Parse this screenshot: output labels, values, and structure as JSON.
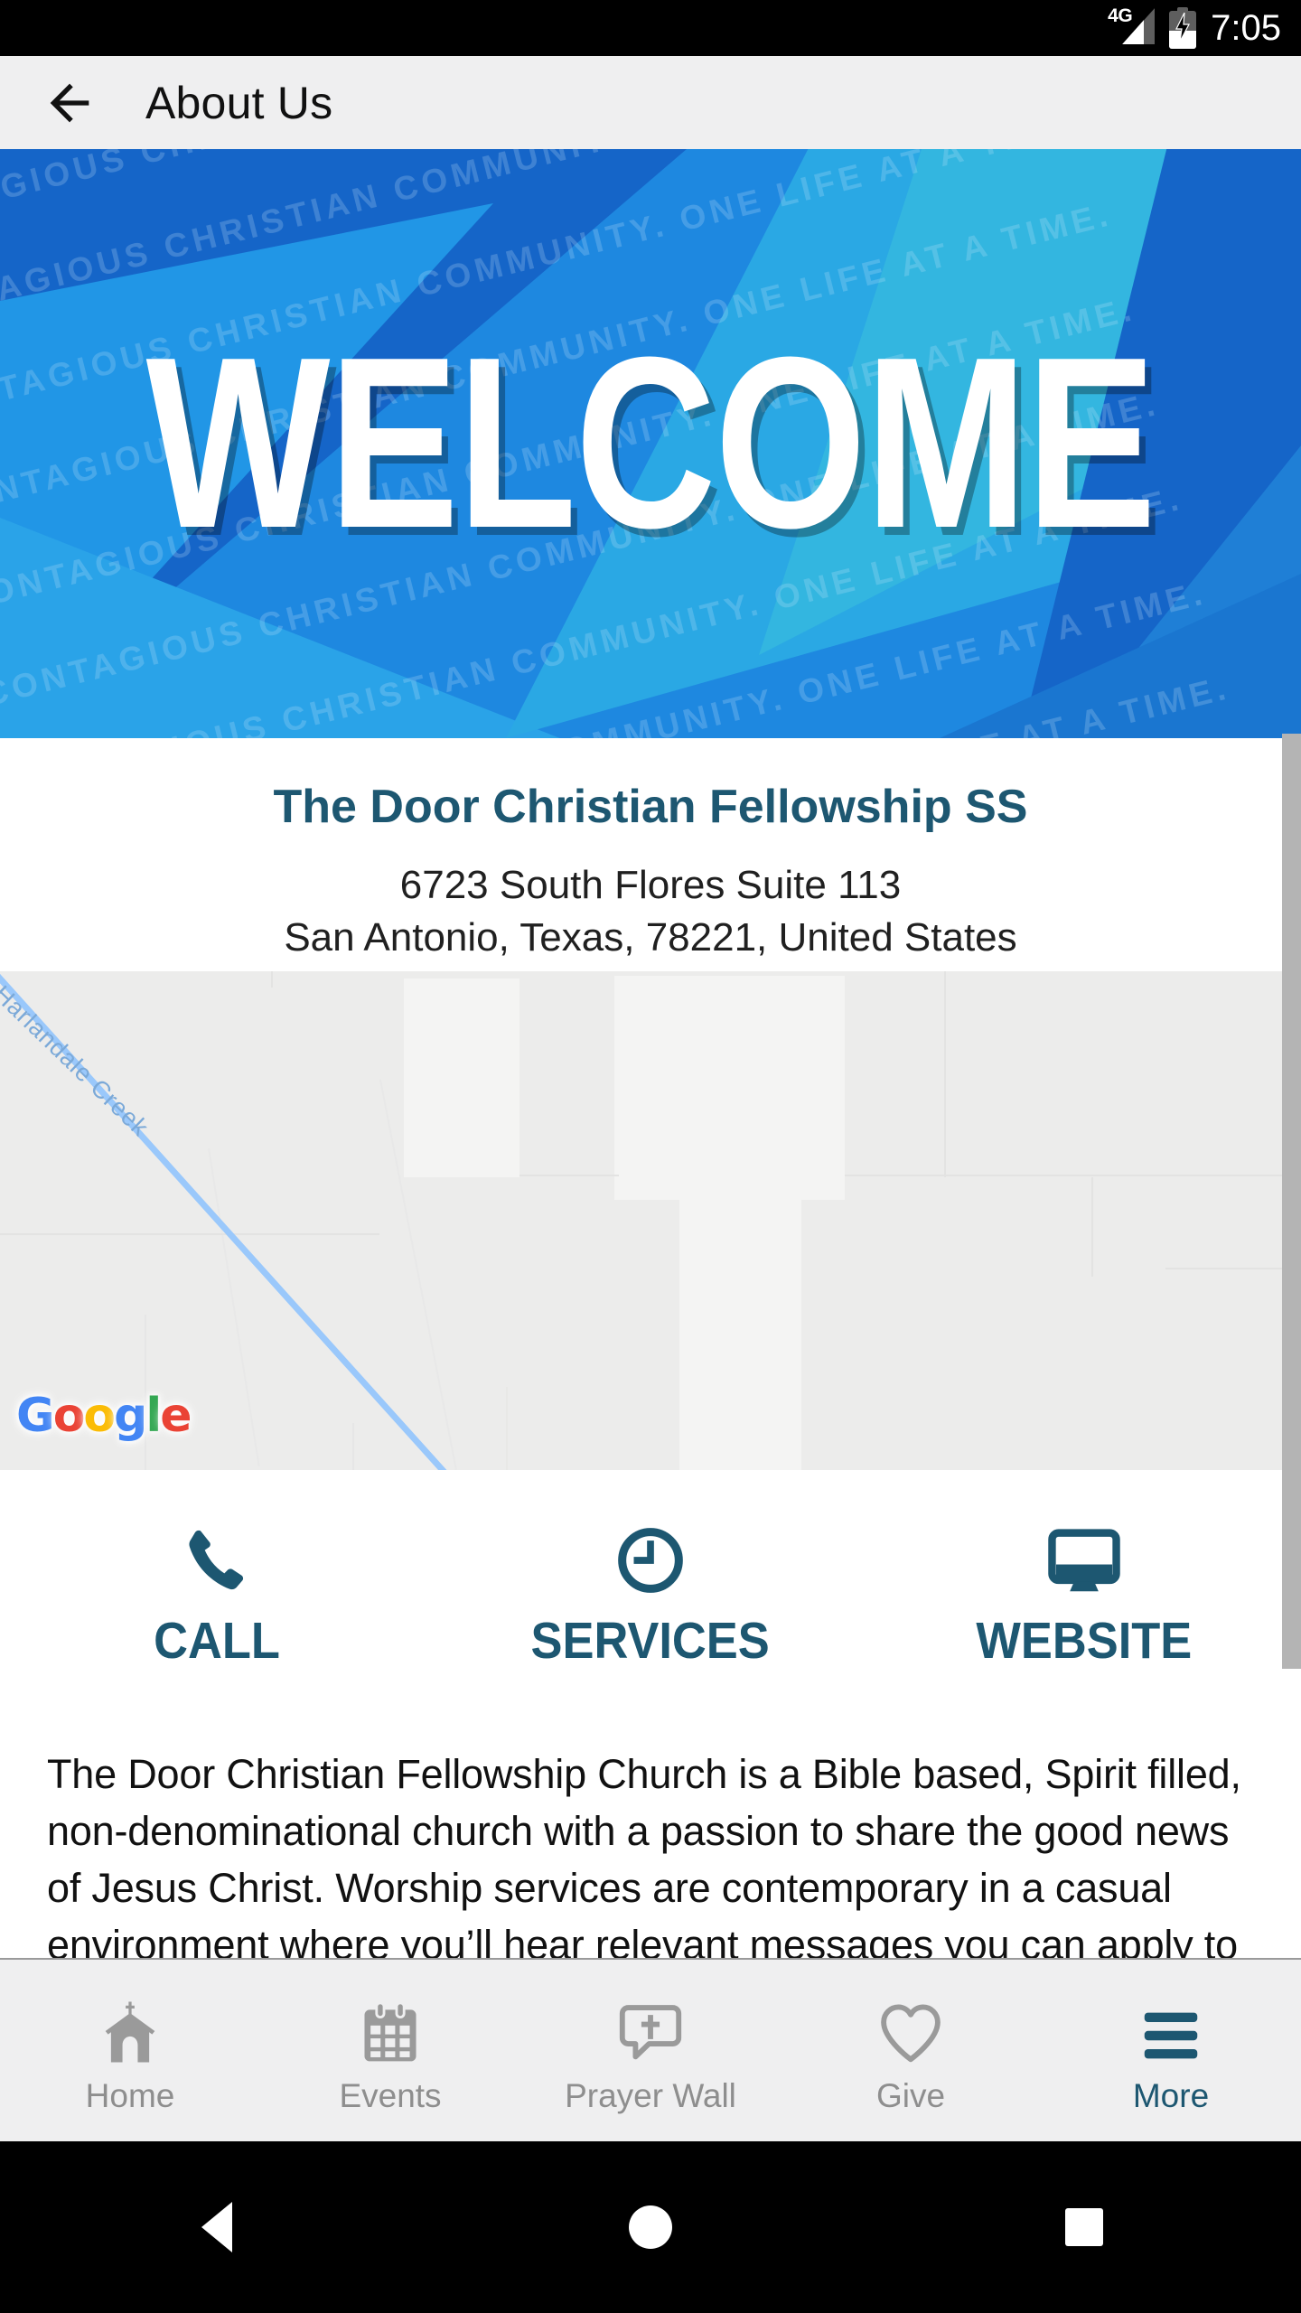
{
  "status_bar": {
    "network": "4G",
    "time": "7:05",
    "battery_icon": "battery-charging-icon",
    "signal_icon": "signal-bars-icon"
  },
  "app_bar": {
    "back_icon": "back-arrow-icon",
    "title": "About Us"
  },
  "hero": {
    "headline": "WELCOME",
    "watermark_text": "BUILDING A CONTAGIOUS CHRISTIAN COMMUNITY. ONE LIFE AT A TIME.",
    "colors": {
      "blue_dark": "#1565c8",
      "blue_mid": "#1e88e0",
      "blue_light": "#2aa3e8",
      "cyan": "#33b6e0"
    }
  },
  "org": {
    "name": "The Door Christian Fellowship SS",
    "address_line1": "6723 South Flores Suite 113",
    "address_line2": "San Antonio, Texas, 78221, United States",
    "name_color": "#1d5771"
  },
  "map": {
    "provider_logo": "Google",
    "provider_letters": [
      "G",
      "o",
      "o",
      "g",
      "l",
      "e"
    ],
    "creek_label": "Harlandale Creek",
    "marker_icon": "map-pin-icon",
    "marker_color": "#f0776a"
  },
  "actions": [
    {
      "label": "CALL",
      "icon": "phone-icon"
    },
    {
      "label": "SERVICES",
      "icon": "clock-icon"
    },
    {
      "label": "WEBSITE",
      "icon": "monitor-icon"
    }
  ],
  "description": {
    "body": "The Door Christian Fellowship Church is a Bible based, Spirit filled, non-denominational church with a passion to share the good news of Jesus Christ. Worship services are contemporary in a casual environment where you’ll hear relevant messages you can apply to everyday life."
  },
  "tabs": [
    {
      "label": "Home",
      "icon": "church-icon",
      "active": false
    },
    {
      "label": "Events",
      "icon": "calendar-icon",
      "active": false
    },
    {
      "label": "Prayer Wall",
      "icon": "prayer-bubble-icon",
      "active": false
    },
    {
      "label": "Give",
      "icon": "heart-icon",
      "active": false
    },
    {
      "label": "More",
      "icon": "hamburger-menu-icon",
      "active": true
    }
  ],
  "android_nav": {
    "back": "back-triangle-icon",
    "home": "home-circle-icon",
    "recents": "recents-square-icon"
  },
  "accent_color": "#1d5771",
  "inactive_color": "#8e8e8e"
}
